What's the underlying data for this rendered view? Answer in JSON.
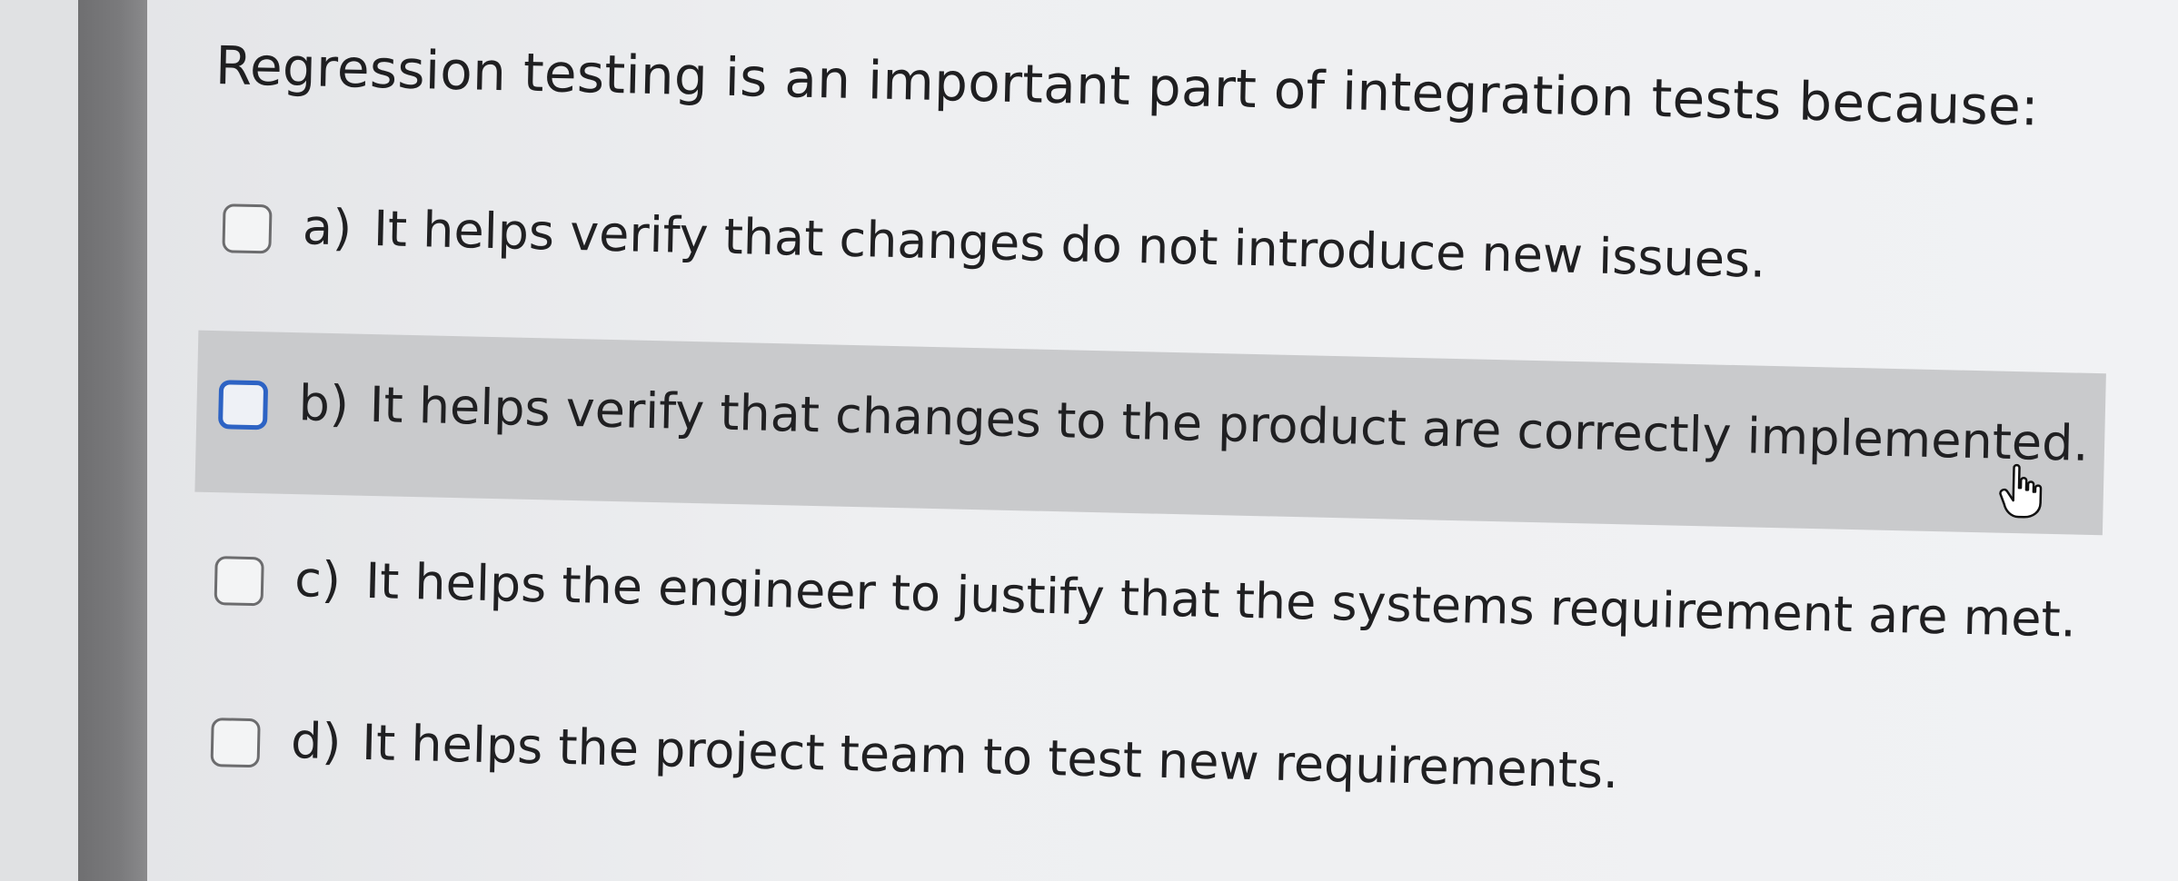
{
  "question": {
    "text": "Regression testing is an important part of integration tests because:"
  },
  "options": [
    {
      "letter": "a)",
      "text": "It helps verify that changes do not introduce new issues.",
      "hovered": false
    },
    {
      "letter": "b)",
      "text": "It helps verify that changes to the product are correctly implemented.",
      "hovered": true
    },
    {
      "letter": "c)",
      "text": "It helps the engineer to justify that the systems requirement are met.",
      "hovered": false
    },
    {
      "letter": "d)",
      "text": "It helps the project team to test new requirements.",
      "hovered": false
    }
  ],
  "colors": {
    "hover_background": "#c9cacc",
    "focus_checkbox_border": "#2d63c4",
    "checkbox_border": "#6c6c6e",
    "text": "#1f1f21"
  },
  "icons": {
    "cursor": "hand-pointer-icon",
    "checkbox": "checkbox-icon"
  }
}
